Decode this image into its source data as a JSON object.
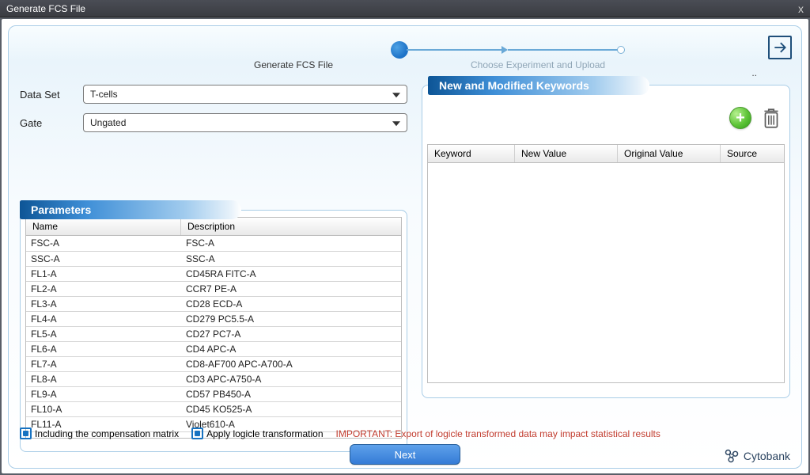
{
  "window": {
    "title": "Generate FCS File",
    "close_glyph": "x"
  },
  "stepper": {
    "step1_label": "Generate FCS File",
    "step2_label": "Choose Experiment and Upload",
    "dots": ".."
  },
  "exit_icon": "exit",
  "form": {
    "dataset_label": "Data Set",
    "dataset_value": "T-cells",
    "gate_label": "Gate",
    "gate_value": "Ungated"
  },
  "parameters": {
    "header": "Parameters",
    "col_name": "Name",
    "col_desc": "Description",
    "rows": [
      {
        "name": "FSC-A",
        "desc": "FSC-A"
      },
      {
        "name": "SSC-A",
        "desc": "SSC-A"
      },
      {
        "name": "FL1-A",
        "desc": "CD45RA FITC-A"
      },
      {
        "name": "FL2-A",
        "desc": "CCR7 PE-A"
      },
      {
        "name": "FL3-A",
        "desc": "CD28 ECD-A"
      },
      {
        "name": "FL4-A",
        "desc": "CD279 PC5.5-A"
      },
      {
        "name": "FL5-A",
        "desc": "CD27 PC7-A"
      },
      {
        "name": "FL6-A",
        "desc": "CD4 APC-A"
      },
      {
        "name": "FL7-A",
        "desc": "CD8-AF700 APC-A700-A"
      },
      {
        "name": "FL8-A",
        "desc": "CD3 APC-A750-A"
      },
      {
        "name": "FL9-A",
        "desc": "CD57 PB450-A"
      },
      {
        "name": "FL10-A",
        "desc": "CD45 KO525-A"
      },
      {
        "name": "FL11-A",
        "desc": "Violet610-A"
      }
    ]
  },
  "keywords": {
    "header": "New and Modified Keywords",
    "col_keyword": "Keyword",
    "col_new": "New Value",
    "col_orig": "Original Value",
    "col_source": "Source"
  },
  "checks": {
    "comp_label": "Including the compensation matrix",
    "logicle_label": "Apply logicle transformation"
  },
  "warning": "IMPORTANT: Export of logicle transformed data may impact statistical results",
  "next_label": "Next",
  "brand": "Cytobank"
}
